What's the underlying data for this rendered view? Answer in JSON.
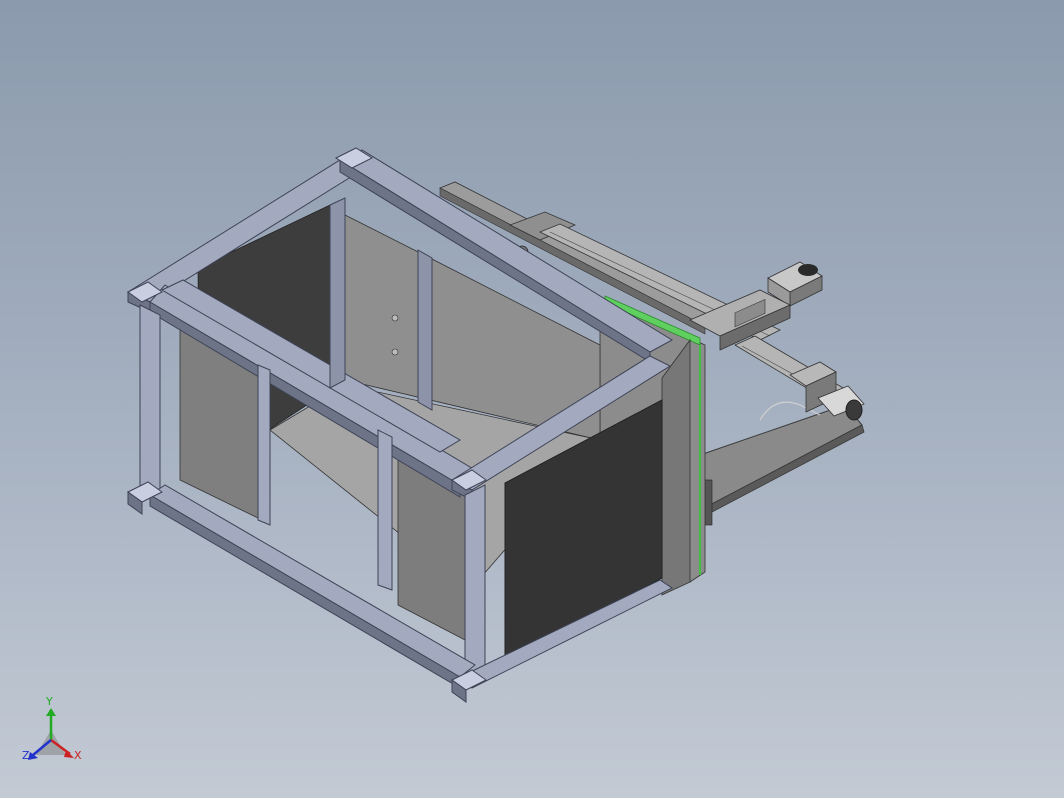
{
  "view": {
    "background_top": "#8b9aad",
    "background_bottom": "#c3cad4"
  },
  "triad": {
    "x_label": "X",
    "y_label": "Y",
    "z_label": "Z",
    "x_color": "#cc2222",
    "y_color": "#22aa22",
    "z_color": "#2233cc"
  },
  "model": {
    "frame_color": "#a3aac0",
    "frame_dark": "#6d7488",
    "panel_dark": "#3c3c3c",
    "panel_light": "#9a9a9a",
    "highlight_edge": "#3fbf3f",
    "arm_color": "#8e8e8e"
  }
}
